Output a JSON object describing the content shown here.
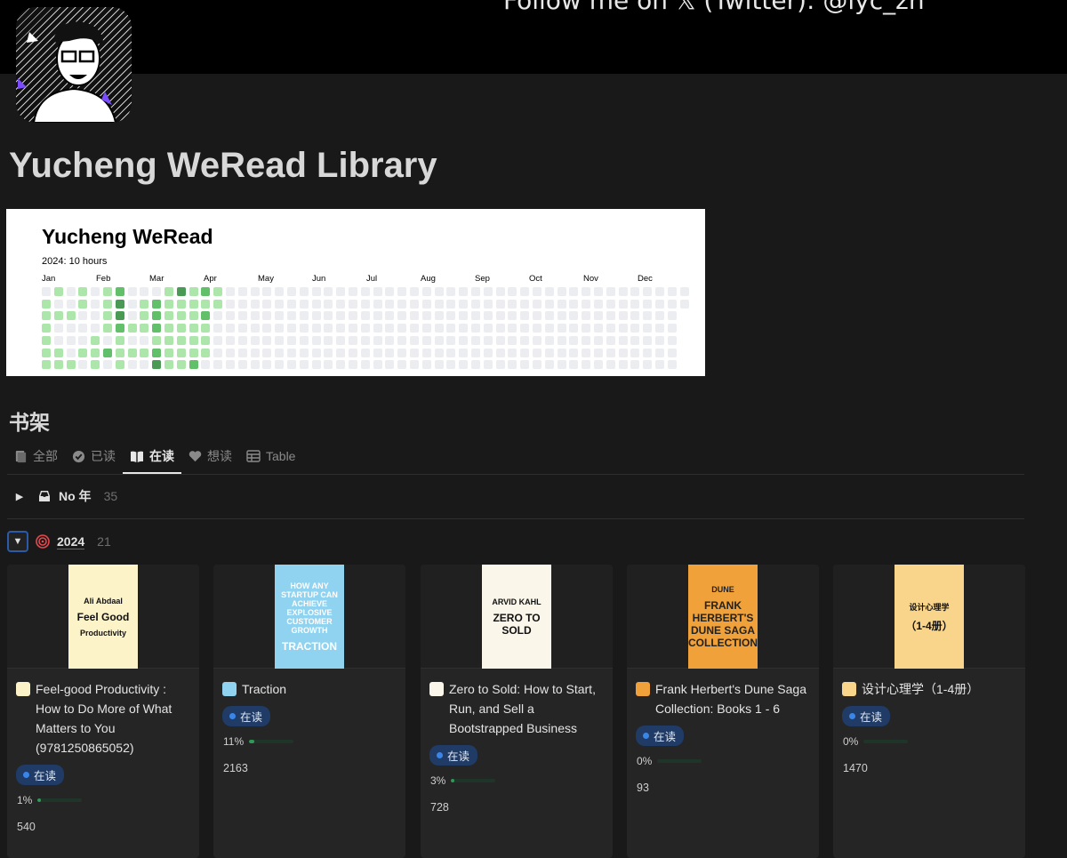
{
  "banner": {
    "text": "Follow me on 𝕏 (Twitter): @iyc_zh"
  },
  "page": {
    "title": "Yucheng WeRead Library"
  },
  "chart_data": {
    "type": "heatmap",
    "title": "Yucheng WeRead",
    "subtitle": "2024: 10 hours",
    "months": [
      "Jan",
      "Feb",
      "Mar",
      "Apr",
      "May",
      "Jun",
      "Jul",
      "Aug",
      "Sep",
      "Oct",
      "Nov",
      "Dec"
    ],
    "weeks": 53,
    "levels_by_weekday": [
      [
        0,
        1,
        0,
        1,
        0,
        1,
        2,
        0,
        0,
        0,
        1,
        3,
        1,
        2,
        1
      ],
      [
        1,
        0,
        0,
        1,
        0,
        1,
        3,
        0,
        1,
        2,
        1,
        1,
        1,
        1,
        1
      ],
      [
        1,
        1,
        1,
        0,
        0,
        1,
        3,
        0,
        1,
        2,
        1,
        1,
        1,
        2
      ],
      [
        1,
        0,
        0,
        0,
        0,
        1,
        2,
        1,
        1,
        2,
        1,
        1,
        1,
        1
      ],
      [
        1,
        0,
        0,
        0,
        1,
        0,
        1,
        0,
        0,
        1,
        1,
        1,
        1,
        1
      ],
      [
        1,
        1,
        0,
        1,
        1,
        2,
        1,
        1,
        1,
        2,
        1,
        1,
        1,
        1
      ],
      [
        1,
        1,
        1,
        0,
        1,
        0,
        1,
        0,
        0,
        3,
        1,
        1,
        2
      ]
    ],
    "colors": [
      "#ebedf0",
      "#acE6aa",
      "#62bf6a",
      "#4a9a55"
    ]
  },
  "shelf": {
    "title": "书架"
  },
  "tabs": [
    {
      "label": "全部",
      "icon": "books-icon"
    },
    {
      "label": "已读",
      "icon": "check-circle-icon"
    },
    {
      "label": "在读",
      "icon": "open-book-icon",
      "active": true
    },
    {
      "label": "想读",
      "icon": "heart-icon"
    },
    {
      "label": "Table",
      "icon": "table-icon"
    }
  ],
  "groups": [
    {
      "label": "No 年",
      "count": "35",
      "expanded": false,
      "icon": "inbox-icon"
    },
    {
      "label": "2024",
      "count": "21",
      "expanded": true,
      "icon": "target-icon"
    }
  ],
  "books": [
    {
      "title": "Feel-good Productivity : How to Do More of What Matters to You (9781250865052)",
      "status": "在读",
      "progress": "1%",
      "progress_value": 1,
      "pages": "540",
      "cover_color": "#fdf3c8",
      "cover_text": [
        "Ali Abdaal",
        "Feel Good",
        "Productivity"
      ]
    },
    {
      "title": "Traction",
      "status": "在读",
      "progress": "11%",
      "progress_value": 11,
      "pages": "2163",
      "cover_color": "#8fd3f0",
      "cover_text": [
        "HOW ANY STARTUP CAN ACHIEVE EXPLOSIVE CUSTOMER GROWTH",
        "TRACTION"
      ]
    },
    {
      "title": "Zero to Sold: How to Start, Run, and Sell a Bootstrapped Business",
      "status": "在读",
      "progress": "3%",
      "progress_value": 3,
      "pages": "728",
      "cover_color": "#fbf6ea",
      "cover_text": [
        "ARVID KAHL",
        "ZERO TO SOLD"
      ]
    },
    {
      "title": "Frank Herbert's Dune Saga Collection: Books 1 - 6",
      "status": "在读",
      "progress": "0%",
      "progress_value": 0,
      "pages": "93",
      "cover_color": "#f0a13a",
      "cover_text": [
        "DUNE",
        "FRANK HERBERT'S DUNE SAGA COLLECTION"
      ]
    },
    {
      "title": "设计心理学（1-4册）",
      "status": "在读",
      "progress": "0%",
      "progress_value": 0,
      "pages": "1470",
      "cover_color": "#f8d58a",
      "cover_text": [
        "设计心理学",
        "（1-4册）"
      ]
    }
  ]
}
